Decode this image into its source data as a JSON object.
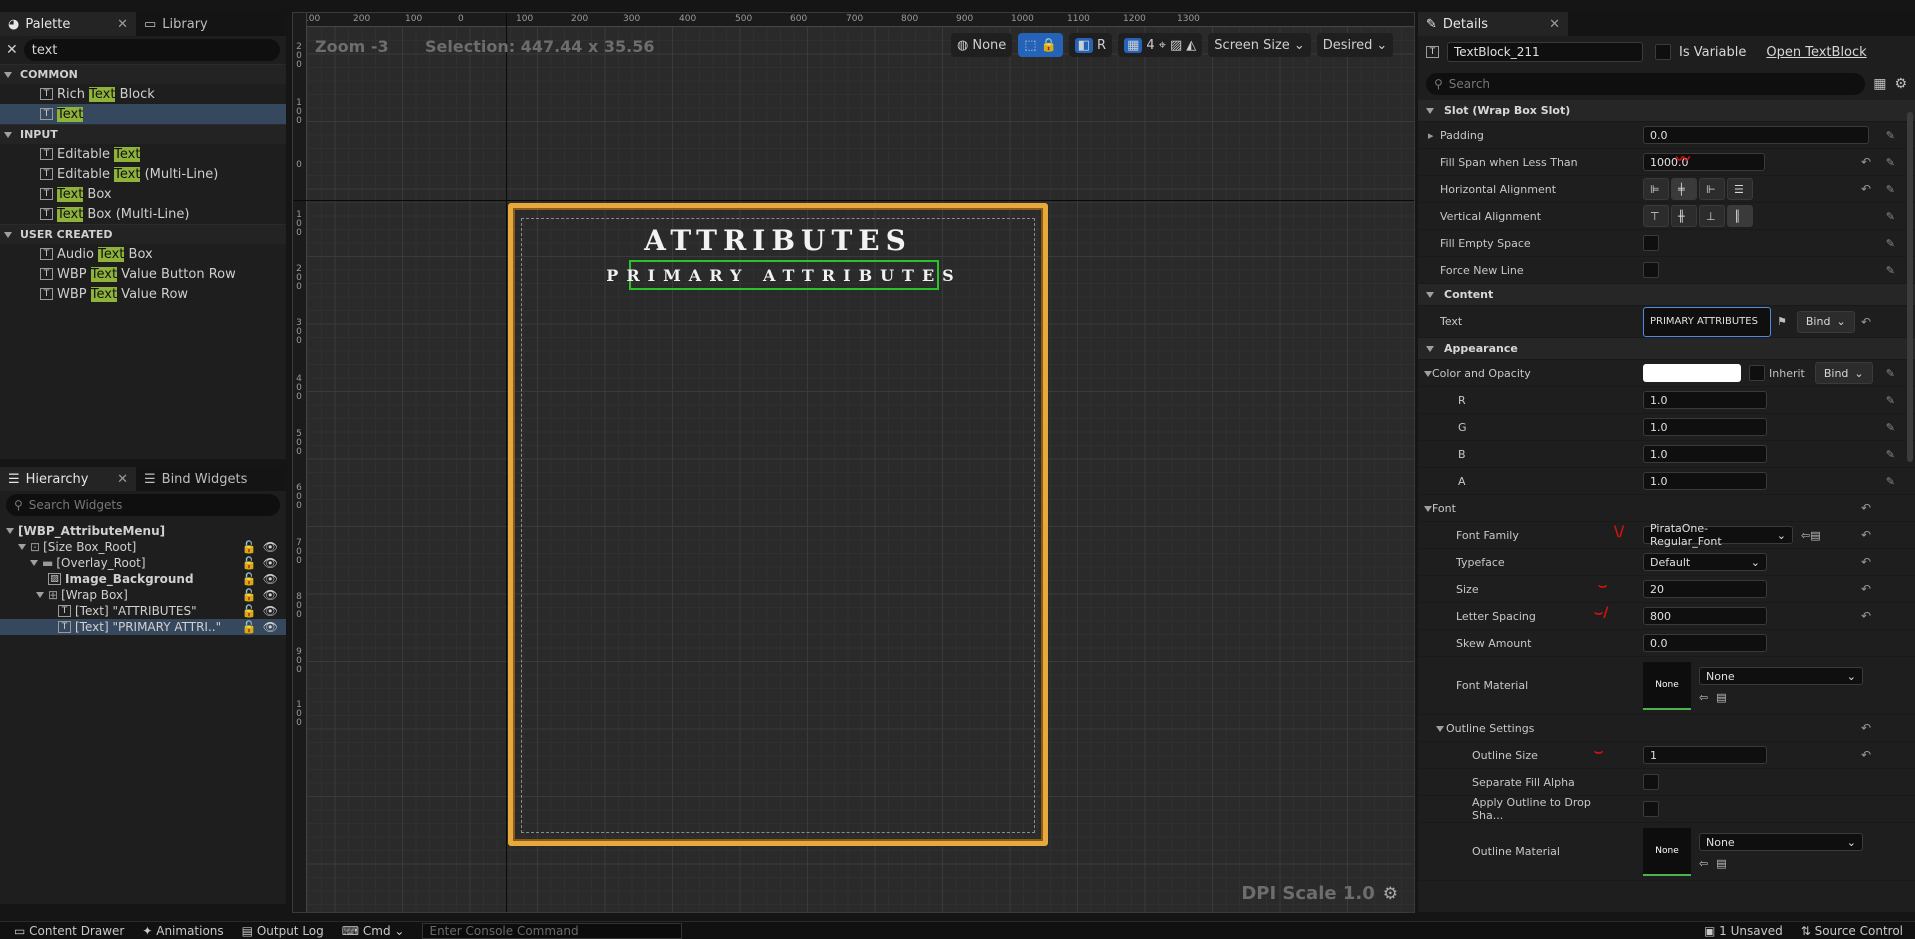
{
  "palette": {
    "tab_label": "Palette",
    "library_tab_label": "Library",
    "search_value": "text",
    "categories": [
      {
        "name": "COMMON",
        "items": [
          {
            "pre": "Rich ",
            "match": "Text",
            "post": " Block"
          },
          {
            "pre": "",
            "match": "Text",
            "post": ""
          }
        ]
      },
      {
        "name": "INPUT",
        "items": [
          {
            "pre": "Editable ",
            "match": "Text",
            "post": ""
          },
          {
            "pre": "Editable ",
            "match": "Text",
            "post": " (Multi-Line)"
          },
          {
            "pre": "",
            "match": "Text",
            "post": " Box"
          },
          {
            "pre": "",
            "match": "Text",
            "post": " Box (Multi-Line)"
          }
        ]
      },
      {
        "name": "USER CREATED",
        "items": [
          {
            "pre": "Audio ",
            "match": "Text",
            "post": " Box"
          },
          {
            "pre": "WBP ",
            "match": "Text",
            "post": " Value Button Row"
          },
          {
            "pre": "WBP ",
            "match": "Text",
            "post": " Value Row"
          }
        ]
      }
    ]
  },
  "hierarchy": {
    "tab_label": "Hierarchy",
    "bind_tab_label": "Bind Widgets",
    "search_placeholder": "Search Widgets",
    "root": "[WBP_AttributeMenu]",
    "size_box": "[Size Box_Root]",
    "overlay": "[Overlay_Root]",
    "image": "Image_Background",
    "wrap_box": "[Wrap Box]",
    "text1": "[Text] \"ATTRIBUTES\"",
    "text2": "[Text] \"PRIMARY ATTRI..\""
  },
  "viewport": {
    "zoom": "Zoom -3",
    "selection": "Selection: 447.44 x 35.56",
    "none_label": "None",
    "r_label": "R",
    "grid_num": "4",
    "screen_size": "Screen Size",
    "desired": "Desired",
    "dpi": "DPI Scale 1.0",
    "title_text": "ATTRIBUTES",
    "subtitle_text": "PRIMARY ATTRIBUTES",
    "ruler_top": [
      "100",
      "200",
      "100",
      "0",
      "100",
      "200",
      "300",
      "400",
      "500",
      "600",
      "700",
      "800",
      "900",
      "1000",
      "1100",
      "1200",
      "1300"
    ],
    "ruler_left": [
      "2\n0\n0",
      "1\n0\n0",
      "0",
      "1\n0\n0",
      "2\n0\n0",
      "3\n0\n0",
      "4\n0\n0",
      "5\n0\n0",
      "6\n0\n0",
      "7\n0\n0",
      "8\n0\n0",
      "9\n0\n0",
      "1\n0\n0"
    ]
  },
  "details": {
    "tab_label": "Details",
    "widget_name": "TextBlock_211",
    "is_variable_label": "Is Variable",
    "open_link": "Open TextBlock",
    "search_placeholder": "Search",
    "slot_section": "Slot (Wrap Box Slot)",
    "padding_label": "Padding",
    "padding_value": "0.0",
    "fill_span_label": "Fill Span when Less Than",
    "fill_span_value": "1000.0",
    "h_align_label": "Horizontal Alignment",
    "v_align_label": "Vertical Alignment",
    "fill_empty_label": "Fill Empty Space",
    "force_new_line_label": "Force New Line",
    "content_section": "Content",
    "text_label": "Text",
    "text_value": "PRIMARY ATTRIBUTES",
    "bind_label": "Bind",
    "appearance_section": "Appearance",
    "color_label": "Color and Opacity",
    "inherit_label": "Inherit",
    "r_label": "R",
    "r_value": "1.0",
    "g_label": "G",
    "g_value": "1.0",
    "b_label": "B",
    "b_value": "1.0",
    "a_label": "A",
    "a_value": "1.0",
    "font_section": "Font",
    "font_family_label": "Font Family",
    "font_family_value": "PirataOne-Regular_Font",
    "typeface_label": "Typeface",
    "typeface_value": "Default",
    "size_label": "Size",
    "size_value": "20",
    "letter_spacing_label": "Letter Spacing",
    "letter_spacing_value": "800",
    "skew_label": "Skew Amount",
    "skew_value": "0.0",
    "font_material_label": "Font Material",
    "none_label": "None",
    "outline_section": "Outline Settings",
    "outline_size_label": "Outline Size",
    "outline_size_value": "1",
    "separate_fill_label": "Separate Fill Alpha",
    "apply_outline_label": "Apply Outline to Drop Sha...",
    "outline_material_label": "Outline Material"
  },
  "bottombar": {
    "content_drawer": "Content Drawer",
    "animations": "Animations",
    "output_log": "Output Log",
    "cmd": "Cmd",
    "console_placeholder": "Enter Console Command",
    "unsaved": "1 Unsaved",
    "source_control": "Source Control"
  }
}
